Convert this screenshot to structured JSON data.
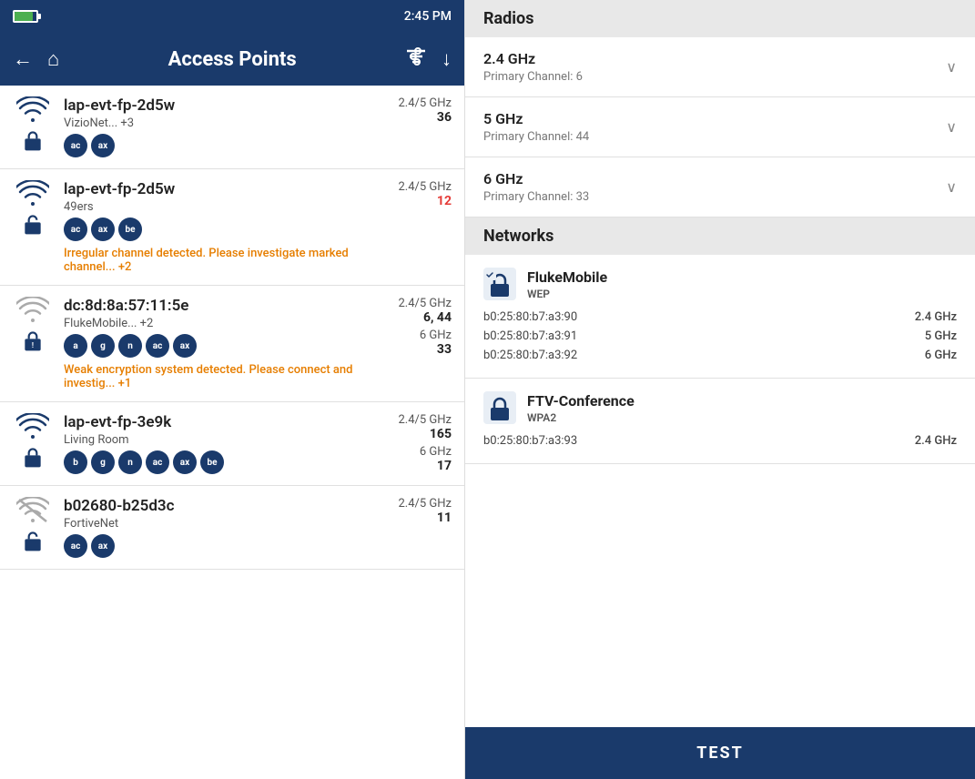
{
  "statusBar": {
    "time": "2:45 PM"
  },
  "topBar": {
    "title": "Access Points",
    "backIcon": "←",
    "homeIcon": "⌂",
    "filterIcon": "≡",
    "downloadIcon": "↓"
  },
  "accessPoints": [
    {
      "id": "ap1",
      "name": "lap-evt-fp-2d5w",
      "network": "VizioNet... +3",
      "signalStrength": "strong",
      "locked": true,
      "bands": [
        {
          "label": "2.4/5 GHz",
          "channel": "36",
          "channelRed": false
        }
      ],
      "badges": [
        "ac",
        "ax"
      ],
      "warning": null
    },
    {
      "id": "ap2",
      "name": "lap-evt-fp-2d5w",
      "network": "49ers",
      "signalStrength": "strong",
      "locked": false,
      "bands": [
        {
          "label": "2.4/5 GHz",
          "channel": "12",
          "channelRed": true
        }
      ],
      "badges": [
        "ac",
        "ax",
        "be"
      ],
      "warning": "Irregular channel detected. Please investigate marked channel... +2"
    },
    {
      "id": "ap3",
      "name": "dc:8d:8a:57:11:5e",
      "network": "FlukeMobile... +2",
      "signalStrength": "weak",
      "locked": true,
      "bands": [
        {
          "label": "2.4/5 GHz",
          "channel": "6, 44",
          "channelRed": false
        },
        {
          "label": "6 GHz",
          "channel": "33",
          "channelRed": false
        }
      ],
      "badges": [
        "a",
        "g",
        "n",
        "ac",
        "ax"
      ],
      "warning": "Weak encryption system detected. Please connect and investig... +1"
    },
    {
      "id": "ap4",
      "name": "lap-evt-fp-3e9k",
      "network": "Living Room",
      "signalStrength": "strong",
      "locked": true,
      "bands": [
        {
          "label": "2.4/5 GHz",
          "channel": "165",
          "channelRed": false
        },
        {
          "label": "6 GHz",
          "channel": "17",
          "channelRed": false
        }
      ],
      "badges": [
        "b",
        "g",
        "n",
        "ac",
        "ax",
        "be"
      ],
      "warning": null
    },
    {
      "id": "ap5",
      "name": "b02680-b25d3c",
      "network": "FortiveNet",
      "signalStrength": "off",
      "locked": true,
      "bands": [
        {
          "label": "2.4/5 GHz",
          "channel": "11",
          "channelRed": false
        }
      ],
      "badges": [
        "ac",
        "ax"
      ],
      "warning": null
    }
  ],
  "rightPanel": {
    "radiosTitle": "Radios",
    "radios": [
      {
        "name": "2.4 GHz",
        "channel": "Primary Channel: 6"
      },
      {
        "name": "5 GHz",
        "channel": "Primary Channel: 44"
      },
      {
        "name": "6 GHz",
        "channel": "Primary Channel: 33"
      }
    ],
    "networksTitle": "Networks",
    "networks": [
      {
        "icon": "wep-lock",
        "name": "FlukeMobile",
        "type": "WEP",
        "entries": [
          {
            "mac": "b0:25:80:b7:a3:90",
            "freq": "2.4 GHz"
          },
          {
            "mac": "b0:25:80:b7:a3:91",
            "freq": "5 GHz"
          },
          {
            "mac": "b0:25:80:b7:a3:92",
            "freq": "6 GHz"
          }
        ]
      },
      {
        "icon": "lock",
        "name": "FTV-Conference",
        "type": "WPA2",
        "entries": [
          {
            "mac": "b0:25:80:b7:a3:93",
            "freq": "2.4 GHz"
          }
        ]
      }
    ],
    "testButton": "TEST"
  }
}
